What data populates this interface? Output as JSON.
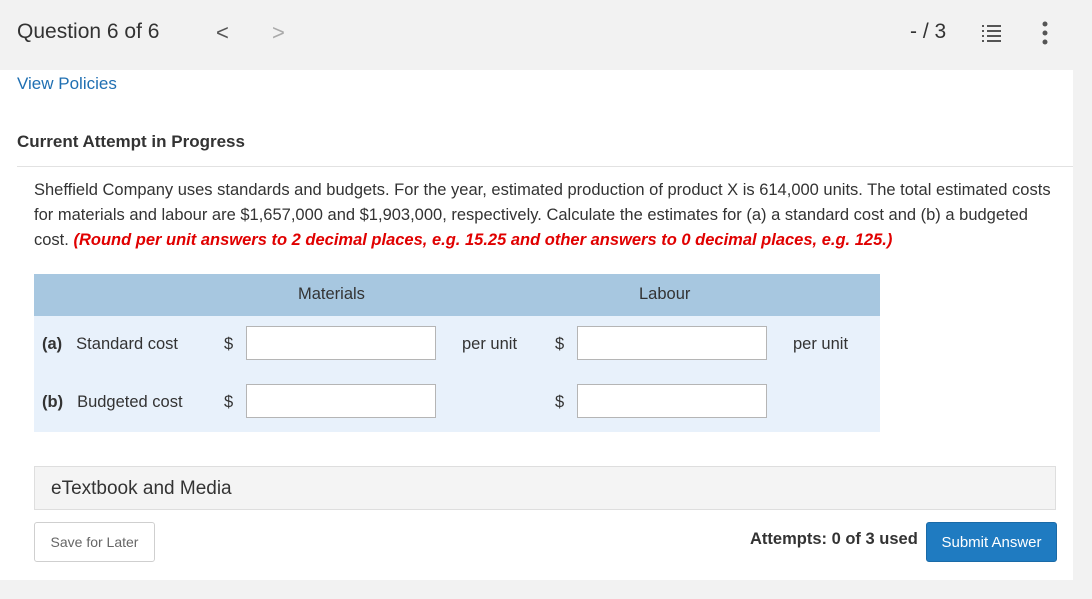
{
  "header": {
    "question_label": "Question 6 of 6",
    "prev_glyph": "<",
    "next_glyph": ">",
    "score": "- / 3"
  },
  "links": {
    "view_policies": "View Policies"
  },
  "attempt_heading": "Current Attempt in Progress",
  "problem": {
    "text": "Sheffield Company uses standards and budgets. For the year, estimated production of product X is 614,000 units. The total estimated costs for materials and labour are $1,657,000 and $1,903,000, respectively. Calculate the estimates for (a) a standard cost and (b) a budgeted cost.",
    "instruction": "(Round per unit answers to 2 decimal places, e.g. 15.25 and other answers to 0 decimal places, e.g. 125.)"
  },
  "table": {
    "headers": {
      "materials": "Materials",
      "labour": "Labour"
    },
    "rows": [
      {
        "letter": "(a)",
        "label": "Standard cost",
        "currency": "$",
        "materials_value": "",
        "labour_value": "",
        "unit": "per unit"
      },
      {
        "letter": "(b)",
        "label": "Budgeted cost",
        "currency": "$",
        "materials_value": "",
        "labour_value": "",
        "unit": ""
      }
    ]
  },
  "etextbook": "eTextbook and Media",
  "footer": {
    "save_label": "Save for Later",
    "attempts": "Attempts: 0 of 3 used",
    "submit_label": "Submit Answer"
  },
  "colors": {
    "link": "#1f6fb2",
    "instruction_red": "#e00000",
    "table_header": "#a7c7e0",
    "table_row": "#e8f1fb",
    "submit_button": "#1f7bc1"
  },
  "icons": [
    "chevron-left-icon",
    "chevron-right-icon",
    "question-list-icon",
    "more-vertical-icon"
  ]
}
